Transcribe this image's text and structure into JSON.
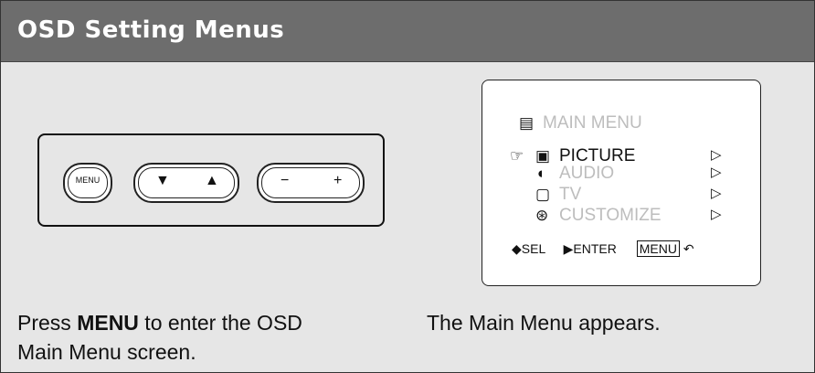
{
  "header": {
    "title": "OSD Setting Menus"
  },
  "panel": {
    "menu_button_label": "MENU",
    "down_symbol": "▼",
    "up_symbol": "▲",
    "minus_symbol": "−",
    "plus_symbol": "+"
  },
  "osd": {
    "title": "MAIN  MENU",
    "items": [
      {
        "label": "PICTURE",
        "state": "selected"
      },
      {
        "label": "AUDIO",
        "state": "dimmed"
      },
      {
        "label": "TV",
        "state": "dimmed"
      },
      {
        "label": "CUSTOMIZE",
        "state": "dimmed"
      }
    ],
    "footer": {
      "sel": "SEL",
      "enter": "ENTER",
      "menu": "MENU"
    }
  },
  "captions": {
    "left_prefix": "Press ",
    "left_bold": "MENU",
    "left_line1_suffix": " to enter the OSD",
    "left_line2": "Main Menu screen.",
    "right": "The Main Menu appears."
  },
  "colors": {
    "header_bg": "#6d6d6d",
    "page_bg": "#e6e6e6",
    "dimmed_text": "#bdbdbd"
  }
}
